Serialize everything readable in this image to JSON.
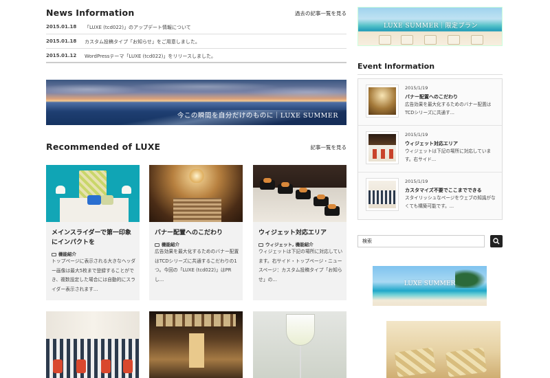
{
  "news": {
    "title": "News Information",
    "more": "過去の記事一覧を見る",
    "items": [
      {
        "date": "2015.01.18",
        "text": "「LUXE (tcd022)」のアップデート情報について"
      },
      {
        "date": "2015.01.18",
        "text": "カスタム投稿タイプ「お知らせ」をご用意しました。"
      },
      {
        "date": "2015.01.12",
        "text": "WordPressテーマ「LUXE (tcd022)」をリリースしました。"
      }
    ]
  },
  "banner": {
    "caption": "今この瞬間を自分だけのものに｜LUXE SUMMER"
  },
  "recommended": {
    "title": "Recommended of LUXE",
    "more": "記事一覧を見る",
    "cards": [
      {
        "title": "メインスライダーで第一印象にインパクトを",
        "category": "機能紹介",
        "desc": "トップページに表示される大きなヘッダー画像は最大5枚まで登録することができ、複数設定した場合には自動的にスライダー表示されます..."
      },
      {
        "title": "バナー配置へのこだわり",
        "category": "機能紹介",
        "desc": "広告効果を最大化するためのバナー配置はTCDシリーズに共通するこだわりの1つ。今回の「LUXE (tcd022)」はPRし..."
      },
      {
        "title": "ウィジェット対応エリア",
        "category": "ウィジェット, 機能紹介",
        "desc": "ウィジェットは下記の場所に対応しています。右サイド・トップページ・ニュースページ：カスタム投稿タイプ「お知らせ」の..."
      }
    ]
  },
  "sidebar": {
    "ad_top_caption": "LUXE SUMMER｜限定プラン",
    "event_title": "Event Information",
    "events": [
      {
        "date": "2015/1/19",
        "name": "バナー配置へのこだわり",
        "desc": "広告効果を最大化するためのバナー配置はTCDシリーズに共通す..."
      },
      {
        "date": "2015/1/19",
        "name": "ウィジェット対応エリア",
        "desc": "ウィジェットは下記の場所に対応しています。右サイド..."
      },
      {
        "date": "2015/1/19",
        "name": "カスタマイズ不要でここまでできる",
        "desc": "スタイリッシュなページをウェブの知識がなくても構築可能です。..."
      }
    ],
    "search_placeholder": "検索",
    "ad_mid_caption": "LUXE SUMMER"
  }
}
